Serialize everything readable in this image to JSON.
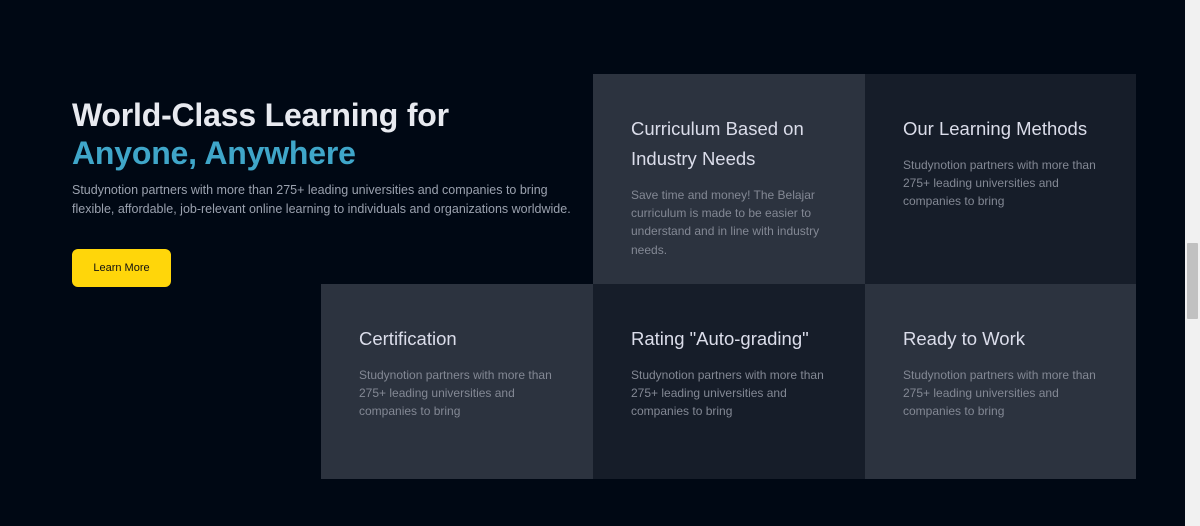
{
  "hero": {
    "title_line1": "World-Class Learning for",
    "title_line2": "Anyone, Anywhere",
    "description": "Studynotion partners with more than 275+ leading universities and companies to bring flexible, affordable, job-relevant online learning to individuals and organizations worldwide.",
    "cta_label": "Learn More"
  },
  "cards": [
    {
      "title": "Curriculum Based on Industry Needs",
      "text": "Save time and money! The Belajar curriculum is made to be easier to understand and in line with industry needs."
    },
    {
      "title": "Our Learning Methods",
      "text": "Studynotion partners with more than 275+ leading universities and companies to bring"
    },
    {
      "title": "Certification",
      "text": "Studynotion partners with more than 275+ leading universities and companies to bring"
    },
    {
      "title": "Rating \"Auto-grading\"",
      "text": "Studynotion partners with more than 275+ leading universities and companies to bring"
    },
    {
      "title": "Ready to Work",
      "text": "Studynotion partners with more than 275+ leading universities and companies to bring"
    }
  ],
  "colors": {
    "background": "#000814",
    "accent_gradient_text": "#3FA6C9",
    "cta_yellow": "#FFD60A",
    "card_light": "#2C333F",
    "card_dark": "#161D29"
  }
}
